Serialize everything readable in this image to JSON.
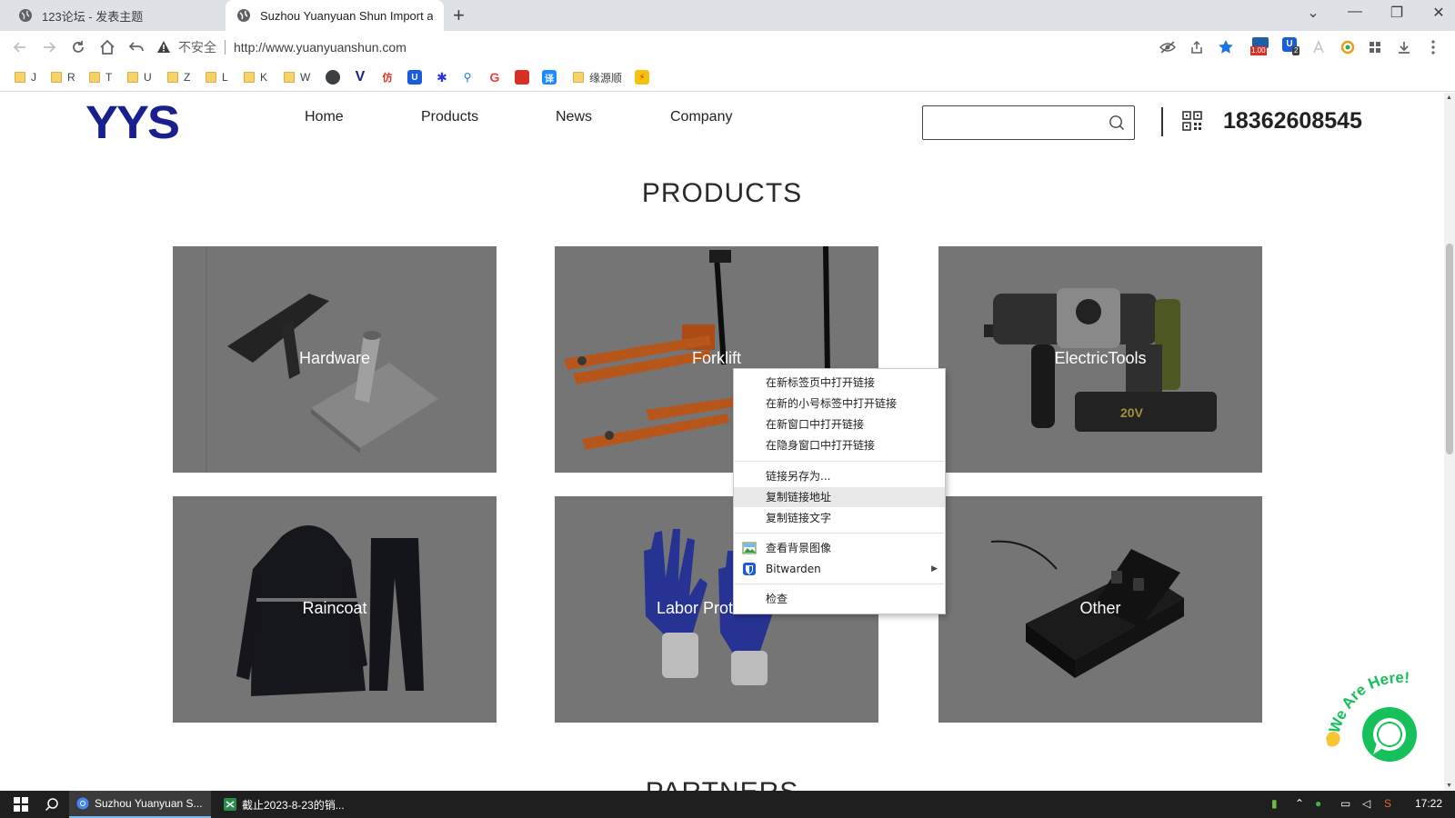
{
  "browser": {
    "tabs": [
      {
        "title": "123论坛 - 发表主题",
        "active": false
      },
      {
        "title": "Suzhou Yuanyuan Shun Import and Export",
        "active": true
      }
    ],
    "new_tab": "+",
    "window_controls": {
      "list": "⌄",
      "minimize": "—",
      "restore": "❐",
      "close": "✕"
    },
    "omnibox": {
      "security_label": "不安全",
      "url": "http://www.yuanyuanshun.com"
    },
    "extensions": {
      "badge_value": "1.00",
      "badge_count": "2"
    },
    "bookmarks": [
      {
        "label": "J",
        "kind": "folder"
      },
      {
        "label": "R",
        "kind": "folder"
      },
      {
        "label": "T",
        "kind": "folder"
      },
      {
        "label": "U",
        "kind": "folder"
      },
      {
        "label": "Z",
        "kind": "folder"
      },
      {
        "label": "L",
        "kind": "folder"
      },
      {
        "label": "K",
        "kind": "folder"
      },
      {
        "label": "W",
        "kind": "folder"
      },
      {
        "label": "",
        "kind": "globe-icon"
      },
      {
        "label": "",
        "kind": "v-icon"
      },
      {
        "label": "仿",
        "kind": "fang-icon"
      },
      {
        "label": "",
        "kind": "bitwarden-icon"
      },
      {
        "label": "",
        "kind": "paw-icon"
      },
      {
        "label": "",
        "kind": "search-icon"
      },
      {
        "label": "",
        "kind": "google-icon"
      },
      {
        "label": "",
        "kind": "red-icon"
      },
      {
        "label": "译",
        "kind": "translate-icon"
      },
      {
        "label": "缘源顺",
        "kind": "folder"
      },
      {
        "label": "",
        "kind": "yellow-icon"
      }
    ]
  },
  "site": {
    "logo": "YYS",
    "nav": [
      "Home",
      "Products",
      "News",
      "Company"
    ],
    "search_placeholder": "",
    "phone": "18362608545",
    "section_title": "PRODUCTS",
    "next_section_title": "PARTNERS",
    "products": [
      {
        "label": "Hardware"
      },
      {
        "label": "Forklift"
      },
      {
        "label": "ElectricTools"
      },
      {
        "label": "Raincoat"
      },
      {
        "label": "Labor Protection"
      },
      {
        "label": "Other"
      }
    ],
    "chat_badge": {
      "text": "We Are Here!"
    }
  },
  "context_menu": {
    "items": [
      {
        "label": "在新标签页中打开链接",
        "highlighted": false
      },
      {
        "label": "在新的小号标签中打开链接",
        "highlighted": false
      },
      {
        "label": "在新窗口中打开链接",
        "highlighted": false
      },
      {
        "label": "在隐身窗口中打开链接",
        "highlighted": false
      },
      {
        "label": "链接另存为...",
        "highlighted": false
      },
      {
        "label": "复制链接地址",
        "highlighted": true
      },
      {
        "label": "复制链接文字",
        "highlighted": false
      },
      {
        "label": "查看背景图像",
        "highlighted": false,
        "icon": "image-icon"
      },
      {
        "label": "Bitwarden",
        "highlighted": false,
        "icon": "bitwarden-icon",
        "submenu": true
      },
      {
        "label": "检查",
        "highlighted": false
      }
    ]
  },
  "taskbar": {
    "apps": [
      {
        "label": "Suzhou Yuanyuan S...",
        "active": true
      },
      {
        "label": "截止2023-8-23的销...",
        "active": false
      }
    ],
    "clock": "17:22"
  },
  "colors": {
    "brand": "#1a1f8f",
    "card_bg": "#8f8f8f",
    "chat_green": "#16c05a",
    "menu_highlight": "#e8e8e8"
  }
}
